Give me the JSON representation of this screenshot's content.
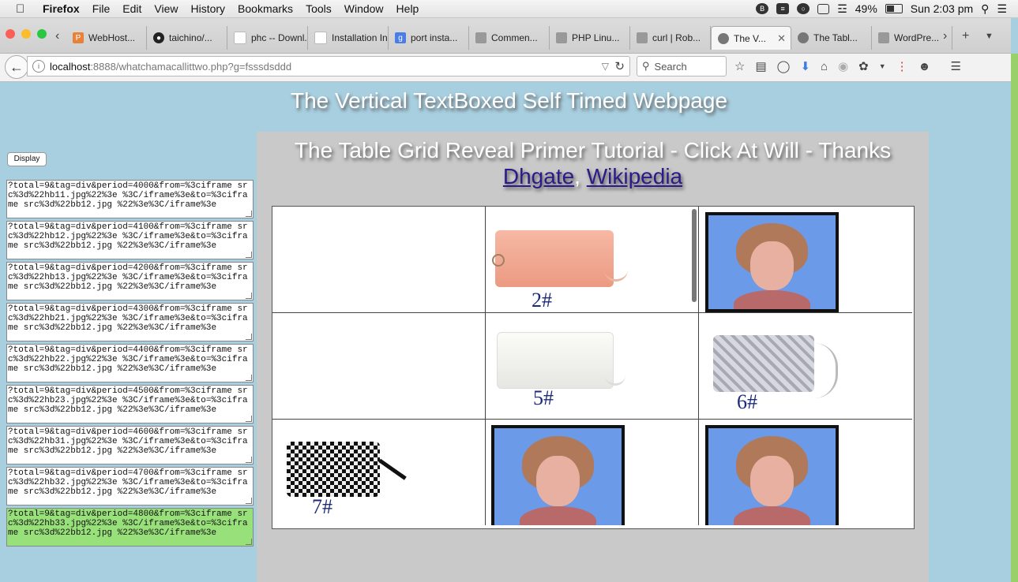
{
  "menubar": {
    "app": "Firefox",
    "items": [
      "File",
      "Edit",
      "View",
      "History",
      "Bookmarks",
      "Tools",
      "Window",
      "Help"
    ],
    "battery": "49%",
    "clock": "Sun 2:03 pm"
  },
  "tabs": [
    {
      "label": "WebHost...",
      "icon": "p-icon",
      "color": "#e8823a"
    },
    {
      "label": "taichino/...",
      "icon": "github-icon",
      "color": "#222222"
    },
    {
      "label": "phc -- Downl...",
      "icon": "page-icon",
      "color": "#ffffff"
    },
    {
      "label": "Installation In...",
      "icon": "page-icon",
      "color": "#ffffff"
    },
    {
      "label": "port insta...",
      "icon": "google-icon",
      "color": "#4a7de8"
    },
    {
      "label": "Commen...",
      "icon": "generic-icon",
      "color": "#999999"
    },
    {
      "label": "PHP Linu...",
      "icon": "generic-icon",
      "color": "#999999"
    },
    {
      "label": "curl | Rob...",
      "icon": "generic-icon",
      "color": "#999999"
    },
    {
      "label": "The V...",
      "icon": "globe-icon",
      "color": "#777777",
      "active": true
    },
    {
      "label": "The Tabl...",
      "icon": "globe-icon",
      "color": "#777777"
    },
    {
      "label": "WordPre...",
      "icon": "generic-icon",
      "color": "#999999"
    }
  ],
  "navbar": {
    "url_host": "localhost",
    "url_path": ":8888/whatchamacallittwo.php?g=fsssdsddd",
    "search_placeholder": "Search"
  },
  "page": {
    "title": "The Vertical TextBoxed Self Timed Webpage",
    "display_button": "Display",
    "textboxes": [
      "?total=9&tag=div&period=4000&from=%3ciframe src%3d%22hb11.jpg%22%3e %3C/iframe%3e&to=%3ciframe src%3d%22bb12.jpg %22%3e%3C/iframe%3e",
      "?total=9&tag=div&period=4100&from=%3ciframe src%3d%22hb12.jpg%22%3e %3C/iframe%3e&to=%3ciframe src%3d%22bb12.jpg %22%3e%3C/iframe%3e",
      "?total=9&tag=div&period=4200&from=%3ciframe src%3d%22hb13.jpg%22%3e %3C/iframe%3e&to=%3ciframe src%3d%22bb12.jpg %22%3e%3C/iframe%3e",
      "?total=9&tag=div&period=4300&from=%3ciframe src%3d%22hb21.jpg%22%3e %3C/iframe%3e&to=%3ciframe src%3d%22bb12.jpg %22%3e%3C/iframe%3e",
      "?total=9&tag=div&period=4400&from=%3ciframe src%3d%22hb22.jpg%22%3e %3C/iframe%3e&to=%3ciframe src%3d%22bb12.jpg %22%3e%3C/iframe%3e",
      "?total=9&tag=div&period=4500&from=%3ciframe src%3d%22hb23.jpg%22%3e %3C/iframe%3e&to=%3ciframe src%3d%22bb12.jpg %22%3e%3C/iframe%3e",
      "?total=9&tag=div&period=4600&from=%3ciframe src%3d%22hb31.jpg%22%3e %3C/iframe%3e&to=%3ciframe src%3d%22bb12.jpg %22%3e%3C/iframe%3e",
      "?total=9&tag=div&period=4700&from=%3ciframe src%3d%22hb32.jpg%22%3e %3C/iframe%3e&to=%3ciframe src%3d%22bb12.jpg %22%3e%3C/iframe%3e",
      "?total=9&tag=div&period=4800&from=%3ciframe src%3d%22hb33.jpg%22%3e %3C/iframe%3e&to=%3ciframe src%3d%22bb12.jpg %22%3e%3C/iframe%3e"
    ],
    "panel_title": "The Table Grid Reveal Primer Tutorial - Click At Will - Thanks",
    "link1": "Dhgate",
    "separator": ",",
    "link2": "Wikipedia",
    "grid": {
      "cells": [
        {
          "kind": "empty"
        },
        {
          "kind": "bag",
          "label": "2#",
          "color": "#f0a890"
        },
        {
          "kind": "portrait"
        },
        {
          "kind": "empty"
        },
        {
          "kind": "bag",
          "label": "5#",
          "color": "#f2f2ee"
        },
        {
          "kind": "bag",
          "label": "6#",
          "color": "#c8c8d0"
        },
        {
          "kind": "bag",
          "label": "7#",
          "color": "#222222"
        },
        {
          "kind": "portrait"
        },
        {
          "kind": "portrait"
        }
      ]
    }
  },
  "colors": {
    "page_bg": "#a8cfe0",
    "panel_bg": "#c9c9c9",
    "active_textbox": "#98e07a",
    "link": "#2b1a8a"
  }
}
